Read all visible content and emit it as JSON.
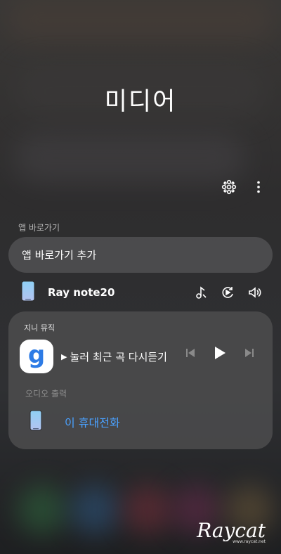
{
  "panel": {
    "title": "미디어"
  },
  "header_icons": [
    "connected-devices-icon",
    "more-vert-icon"
  ],
  "app_shortcuts": {
    "section_label": "앱 바로가기",
    "add_label": "앱 바로가기 추가"
  },
  "device": {
    "name": "Ray note20",
    "icons": [
      "music-note-icon",
      "smart-view-icon",
      "volume-icon"
    ]
  },
  "media_player": {
    "app_name": "지니 뮤직",
    "app_icon_letter": "g",
    "track_title": "눌러 최근 곡 다시듣기",
    "controls": [
      "previous-icon",
      "play-icon",
      "next-icon"
    ],
    "audio_output": {
      "label": "오디오 출력",
      "device": "이 휴대전화"
    }
  },
  "watermark": {
    "logo": "Raycat",
    "url": "www.raycat.net"
  },
  "colors": {
    "accent": "#4aa1ff",
    "card": "#4c4c4e",
    "app_icon_g": "#2d7be5"
  }
}
